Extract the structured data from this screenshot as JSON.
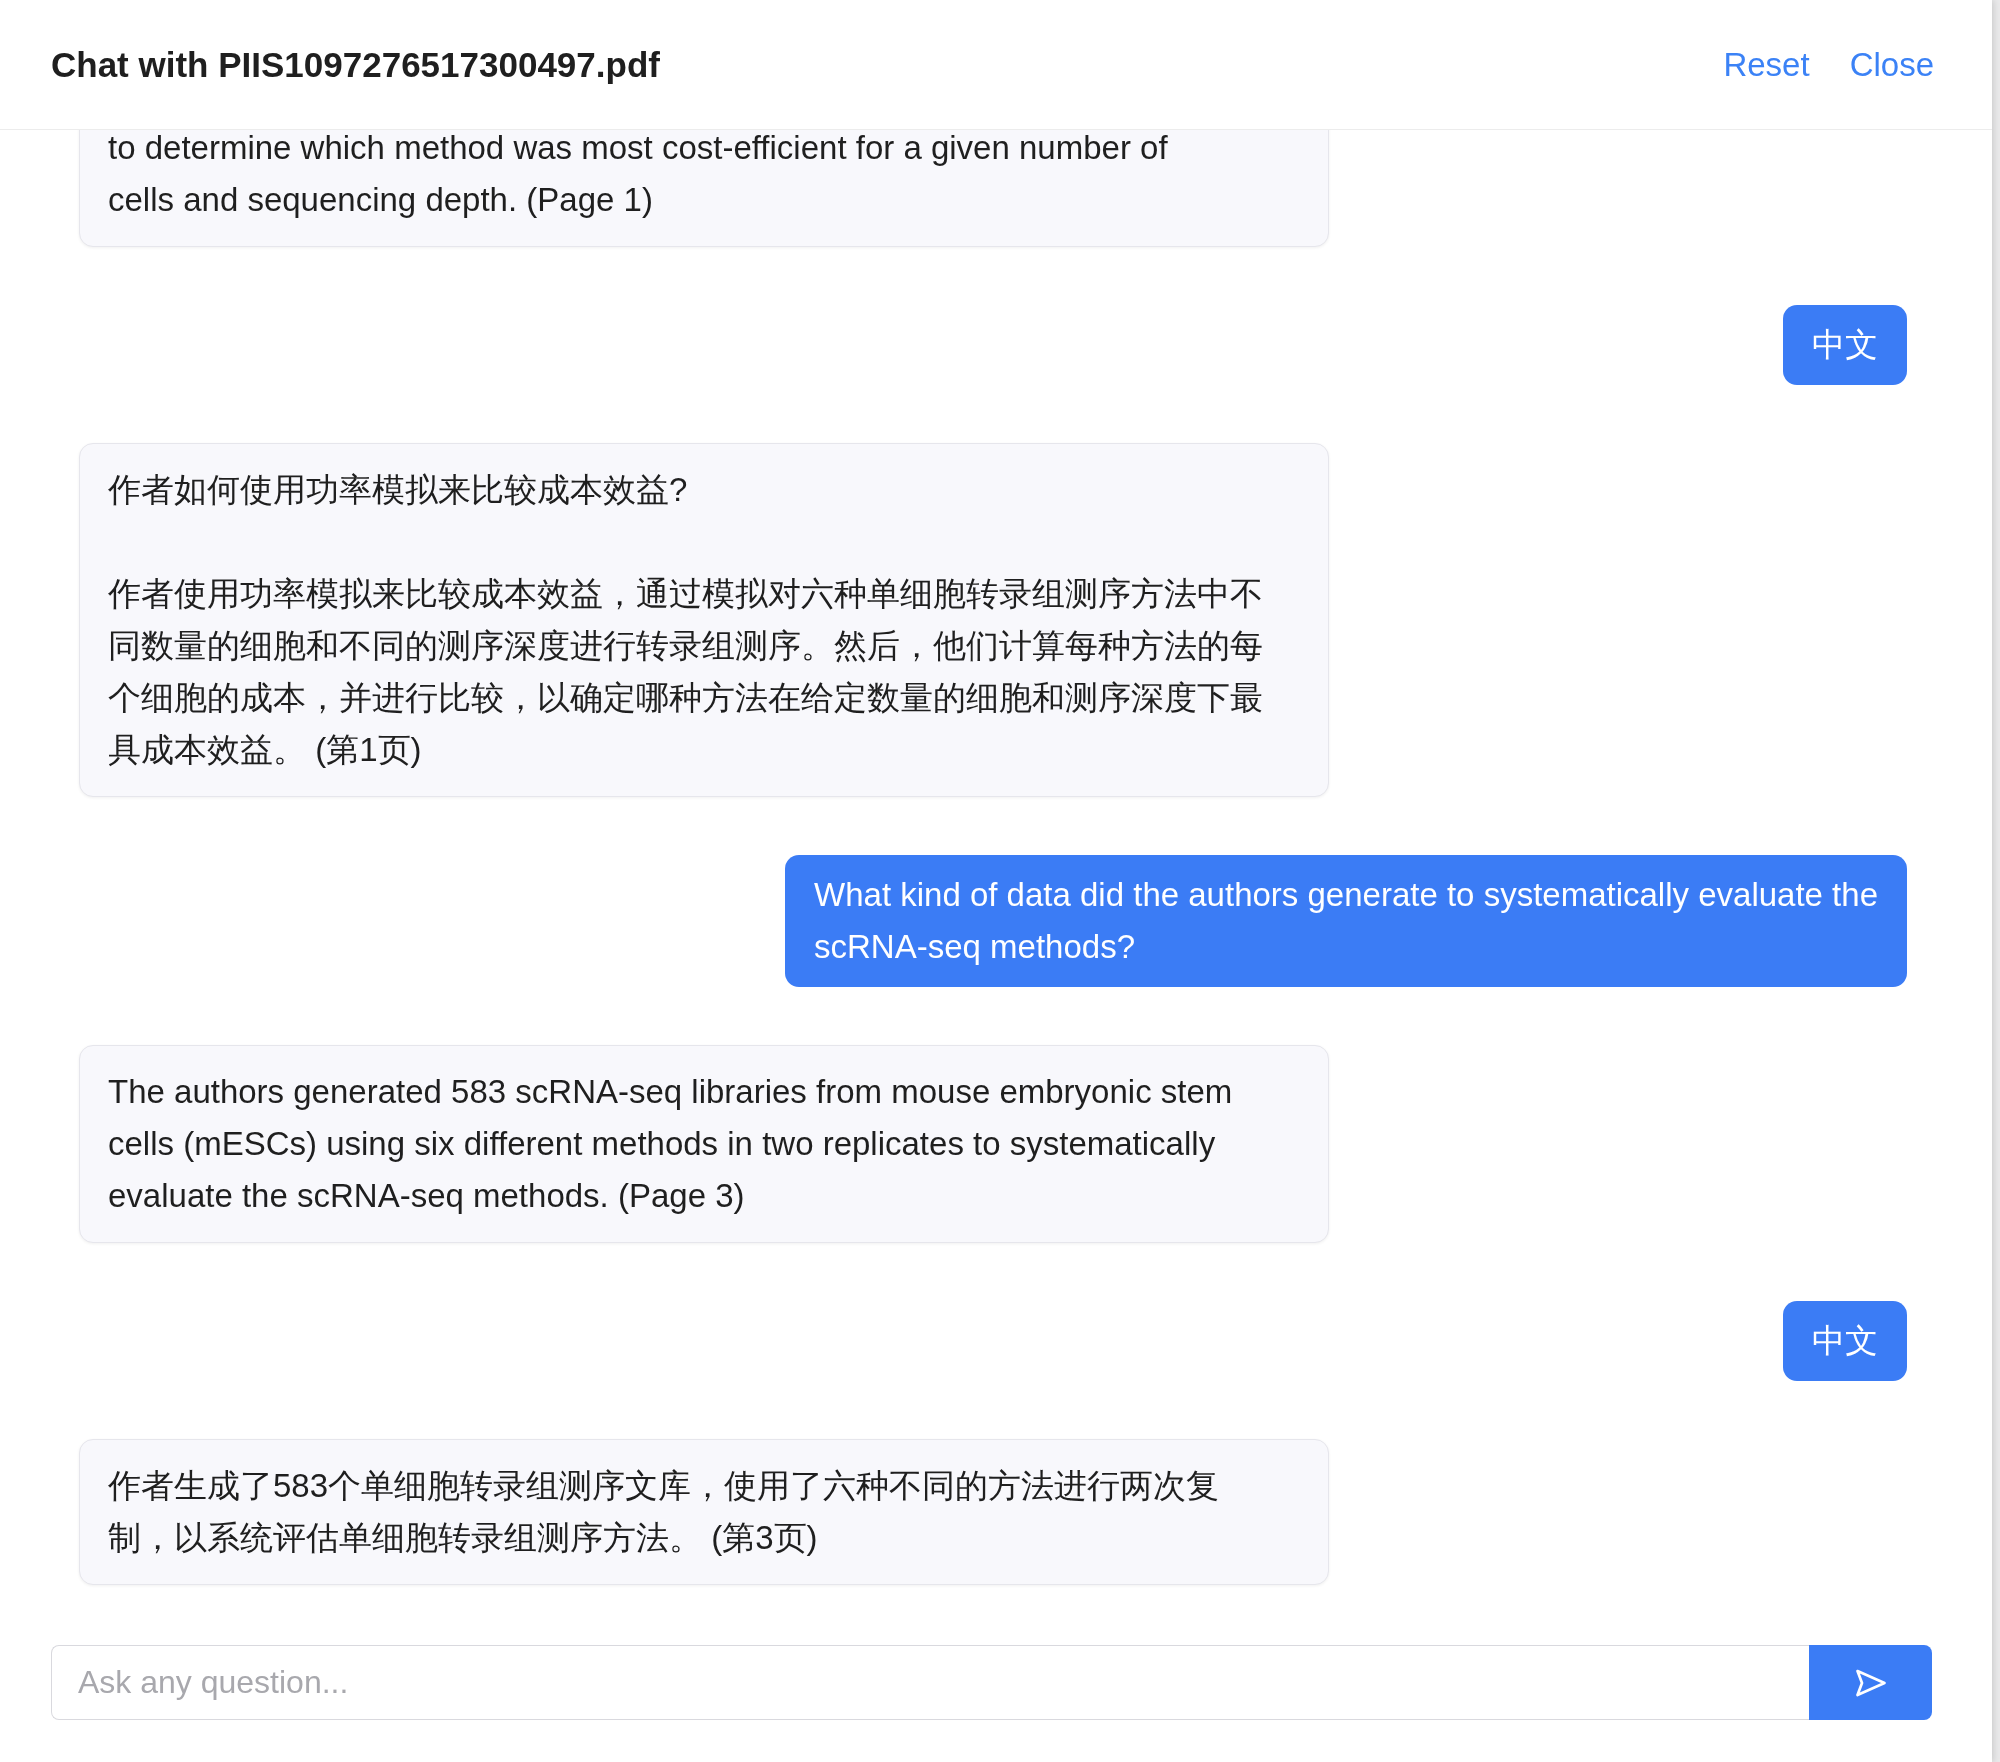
{
  "header": {
    "title": "Chat with PIIS1097276517300497.pdf",
    "actions": [
      "Reset",
      "Close"
    ]
  },
  "messages": [
    {
      "kind": "assistant",
      "text": "to determine which method was most cost-efficient for a given number of\ncells and sequencing depth. (Page 1)"
    },
    {
      "kind": "user",
      "text": "中文"
    },
    {
      "kind": "assistant",
      "text": "作者如何使用功率模拟来比较成本效益?\n\n作者使用功率模拟来比较成本效益，通过模拟对六种单细胞转录组测序方法中不同数量的细胞和不同的测序深度进行转录组测序。然后，他们计算每种方法的每个细胞的成本，并进行比较，以确定哪种方法在给定数量的细胞和测序深度下最具成本效益。 (第1页)"
    },
    {
      "kind": "user",
      "text": "What kind of data did the authors generate to systematically evaluate the\nscRNA-seq methods?"
    },
    {
      "kind": "assistant",
      "text": "The authors generated 583 scRNA-seq libraries from mouse embryonic stem\ncells (mESCs) using six different methods in two replicates to systematically\nevaluate the scRNA-seq methods. (Page 3)"
    },
    {
      "kind": "user",
      "text": "中文"
    },
    {
      "kind": "assistant",
      "text": "作者生成了583个单细胞转录组测序文库，使用了六种不同的方法进行两次复制，以系统评估单细胞转录组测序方法。 (第3页)"
    }
  ],
  "input": {
    "placeholder": "Ask any question..."
  }
}
